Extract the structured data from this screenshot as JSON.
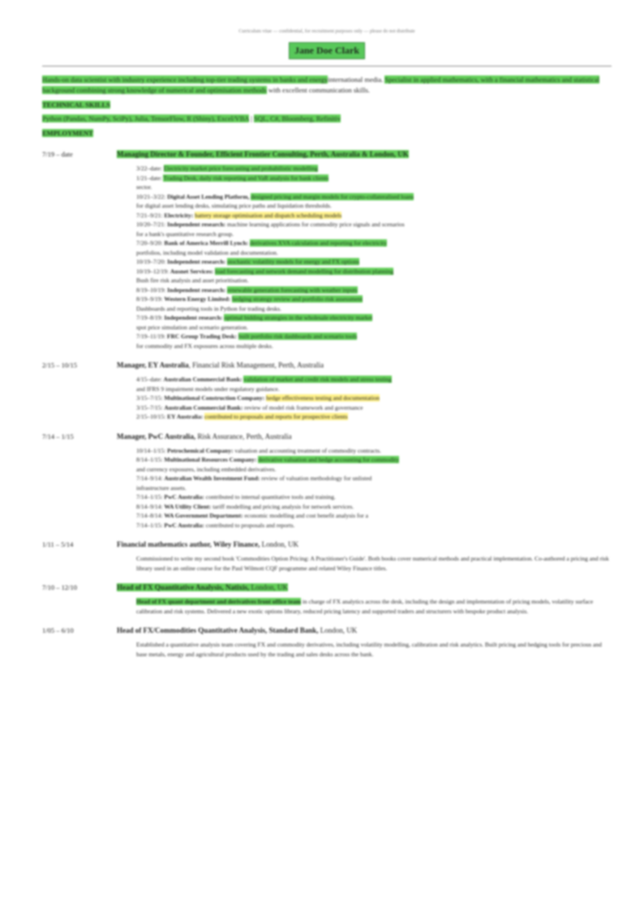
{
  "doc": {
    "top_note": "Curriculum vitae — confidential, for recruitment purposes only — please do not distribute",
    "name": "Jane Doe Clark",
    "summary": [
      {
        "t": "Hands-on data scientist with industry experience including top-tier trading systems in banks and energy",
        "h": "g"
      },
      {
        "t": "international media. ",
        "h": ""
      },
      {
        "t": "Specialist in applied mathematics, with a financial mathematics and statistical background",
        "h": "g"
      },
      {
        "t": " combining strong knowledge of numerical and optimisation methods",
        "h": "g"
      },
      {
        "t": " with excellent communication skills.",
        "h": ""
      }
    ],
    "skills_heading": "TECHNICAL SKILLS",
    "skills_line": [
      {
        "t": "Python (Pandas, NumPy, SciPy), Julia, TensorFlow, R (Shiny), Excel/VBA",
        "h": "g"
      },
      {
        "t": "  |  ",
        "h": ""
      },
      {
        "t": "SQL, C#, Bloomberg, Refinitiv",
        "h": "g"
      }
    ],
    "employment_heading": "EMPLOYMENT",
    "jobs": [
      {
        "date": "7/19 – date",
        "title": [
          {
            "t": "Managing Director & Founder, Efficient Frontier Consulting, Perth, Australia & London, UK",
            "h": "g",
            "b": true
          }
        ],
        "lines": [
          [
            {
              "t": "3/22–date: ",
              "h": ""
            },
            {
              "t": "Electricity market price forecasting and probabilistic modelling",
              "h": "g"
            }
          ],
          [
            {
              "t": "1/21–date: ",
              "h": ""
            },
            {
              "t": "Trading Desk, daily risk reporting and VaR analysis for bank clients",
              "h": "g"
            }
          ],
          [
            {
              "t": "sector.",
              "h": ""
            }
          ],
          [
            {
              "t": "10/21–3/22: ",
              "h": ""
            },
            {
              "t": "Digital Asset Lending Platform, ",
              "h": "",
              "b": true
            },
            {
              "t": "designed pricing and margin models for crypto-collateralised loans",
              "h": "g"
            }
          ],
          [
            {
              "t": "for digital asset lending desks, simulating price paths and liquidation thresholds.",
              "h": ""
            }
          ],
          [
            {
              "t": "7/21–9/21: ",
              "h": ""
            },
            {
              "t": "Electricity: ",
              "h": "",
              "b": true
            },
            {
              "t": "battery storage optimisation and dispatch scheduling models",
              "h": "y"
            }
          ],
          [
            {
              "t": "10/20–7/21: ",
              "h": ""
            },
            {
              "t": "Independent research: ",
              "h": "",
              "b": true
            },
            {
              "t": "machine learning applications for commodity price signals and scenarios",
              "h": ""
            }
          ],
          [
            {
              "t": "for a bank's quantitative research group.",
              "h": ""
            }
          ],
          [
            {
              "t": "7/20–9/20: ",
              "h": ""
            },
            {
              "t": "Bank of America Merrill Lynch: ",
              "h": "",
              "b": true
            },
            {
              "t": "derivatives XVA calculation and reporting for electricity",
              "h": "g"
            }
          ],
          [
            {
              "t": "portfolios, including model validation and documentation.",
              "h": ""
            }
          ],
          [
            {
              "t": "10/19–7/20: ",
              "h": ""
            },
            {
              "t": "Independent research: ",
              "h": "",
              "b": true
            },
            {
              "t": "stochastic volatility models for energy and FX options",
              "h": "g"
            }
          ],
          [
            {
              "t": "10/19–12/19: ",
              "h": ""
            },
            {
              "t": "Ausnet Services: ",
              "h": "",
              "b": true
            },
            {
              "t": "load forecasting and network demand modelling for distribution planning",
              "h": "g"
            }
          ],
          [
            {
              "t": "Bush fire risk analysis and asset prioritisation.",
              "h": ""
            }
          ],
          [
            {
              "t": "8/19–10/19: ",
              "h": ""
            },
            {
              "t": "Independent research: ",
              "h": "",
              "b": true
            },
            {
              "t": "renewable generation forecasting with weather inputs",
              "h": "g"
            }
          ],
          [
            {
              "t": "8/19–9/19: ",
              "h": ""
            },
            {
              "t": "Western Energy Limited: ",
              "h": "",
              "b": true
            },
            {
              "t": "hedging strategy review and portfolio risk assessment",
              "h": "g"
            }
          ],
          [
            {
              "t": "Dashboards and reporting tools in Python for trading desks.",
              "h": ""
            }
          ],
          [
            {
              "t": "7/19–8/19: ",
              "h": ""
            },
            {
              "t": "Independent research: ",
              "h": "",
              "b": true
            },
            {
              "t": "optimal bidding strategies in the wholesale electricity market",
              "h": "g"
            }
          ],
          [
            {
              "t": "spot price simulation and scenario generation.",
              "h": ""
            }
          ],
          [
            {
              "t": "7/19–11/19: ",
              "h": ""
            },
            {
              "t": "FRC Group Trading Desk: ",
              "h": "",
              "b": true
            },
            {
              "t": "built portfolio risk dashboards and scenario tools",
              "h": "g"
            }
          ],
          [
            {
              "t": "for commodity and FX exposures across multiple desks.",
              "h": ""
            }
          ]
        ]
      },
      {
        "date": "2/15 – 10/15",
        "title": [
          {
            "t": "Manager, ",
            "h": "",
            "b": true
          },
          {
            "t": "EY ",
            "h": "",
            "b": true
          },
          {
            "t": "Australia",
            "h": "",
            "b": true
          },
          {
            "t": ", Financial Risk Management, Perth, Australia",
            "h": ""
          }
        ],
        "lines": [
          [
            {
              "t": "4/15–date: ",
              "h": ""
            },
            {
              "t": "Australian Commercial Bank: ",
              "h": "",
              "b": true
            },
            {
              "t": "validation of market and credit risk models and stress testing",
              "h": "g"
            }
          ],
          [
            {
              "t": "and IFRS 9 impairment models under regulatory guidance.",
              "h": ""
            }
          ],
          [
            {
              "t": "3/15–7/15: ",
              "h": ""
            },
            {
              "t": "Multinational Construction Company: ",
              "h": "",
              "b": true
            },
            {
              "t": "hedge effectiveness testing and documentation",
              "h": "y"
            }
          ],
          [
            {
              "t": "3/15–7/15: ",
              "h": ""
            },
            {
              "t": "Australian Commercial Bank: ",
              "h": "",
              "b": true
            },
            {
              "t": "review of model risk framework and governance",
              "h": ""
            }
          ],
          [
            {
              "t": "2/15–10/15: ",
              "h": ""
            },
            {
              "t": "EY Australia: ",
              "h": "",
              "b": true
            },
            {
              "t": "contributed to proposals and reports for prospective clients",
              "h": "y"
            }
          ]
        ]
      },
      {
        "date": "7/14 – 1/15",
        "title": [
          {
            "t": "Manager, PwC Australia, ",
            "h": "",
            "b": true
          },
          {
            "t": "Risk Assurance, Perth, Australia",
            "h": ""
          }
        ],
        "lines": [
          [
            {
              "t": "10/14–1/15: ",
              "h": ""
            },
            {
              "t": "Petrochemical Company: ",
              "h": "",
              "b": true
            },
            {
              "t": "valuation and accounting treatment of commodity contracts.",
              "h": ""
            }
          ],
          [
            {
              "t": "8/14–1/15: ",
              "h": ""
            },
            {
              "t": "Multinational Resources Company: ",
              "h": "",
              "b": true
            },
            {
              "t": "derivative valuation and hedge accounting for commodity",
              "h": "g"
            }
          ],
          [
            {
              "t": "and currency exposures, including embedded derivatives.",
              "h": ""
            }
          ],
          [
            {
              "t": "7/14–9/14: ",
              "h": ""
            },
            {
              "t": "Australian Wealth Investment Fund: ",
              "h": "",
              "b": true
            },
            {
              "t": "review of valuation methodology for unlisted",
              "h": ""
            }
          ],
          [
            {
              "t": "infrastructure assets.",
              "h": ""
            }
          ],
          [
            {
              "t": "7/14–1/15: ",
              "h": ""
            },
            {
              "t": "PwC Australia: ",
              "h": "",
              "b": true
            },
            {
              "t": "contributed to internal quantitative tools and training.",
              "h": ""
            }
          ],
          [
            {
              "t": "8/14–9/14: ",
              "h": ""
            },
            {
              "t": "WA Utility Client: ",
              "h": "",
              "b": true
            },
            {
              "t": "tariff modelling and pricing analysis for network services.",
              "h": ""
            }
          ],
          [
            {
              "t": "7/14–8/14: ",
              "h": ""
            },
            {
              "t": "WA Government Department: ",
              "h": "",
              "b": true
            },
            {
              "t": "economic modelling and cost benefit analysis for a",
              "h": ""
            }
          ],
          [
            {
              "t": "7/14–1/15: ",
              "h": ""
            },
            {
              "t": "PwC Australia: ",
              "h": "",
              "b": true
            },
            {
              "t": "contributed to proposals and reports.",
              "h": ""
            }
          ]
        ]
      },
      {
        "date": "1/11 – 5/14",
        "title": [
          {
            "t": "Financial mathematics author, Wiley Finance, ",
            "h": "",
            "b": true
          },
          {
            "t": "London, UK",
            "h": ""
          }
        ],
        "para": "Commissioned to write my second book 'Commodities Option Pricing: A Practitioner's Guide'. Both books cover numerical methods and practical implementation. Co-authored a pricing and risk library used in an online course for the Paul Wilmott CQF programme and related Wiley Finance titles.",
        "para_hl": ""
      },
      {
        "date": "7/10 – 12/10",
        "title": [
          {
            "t": "Head of FX Quantitative Analysis, Natixis, ",
            "h": "g",
            "b": true
          },
          {
            "t": "London, UK",
            "h": "g"
          }
        ],
        "para_hl": "Head of FX quant department and derivatives front office team",
        "para": " in charge of FX analytics across the desk, including the design and implementation of pricing models, volatility surface calibration and risk systems. Delivered a new exotic options library, reduced pricing latency and supported traders and structurers with bespoke product analysis."
      },
      {
        "date": "1/05 – 6/10",
        "title": [
          {
            "t": "Head of FX/Commodities Quantitative Analysis, Standard Bank, ",
            "h": "",
            "b": true
          },
          {
            "t": "London, UK",
            "h": ""
          }
        ],
        "para_hl": "",
        "para": "Established a quantitative analysis team covering FX and commodity derivatives, including volatility modelling, calibration and risk analytics. Built pricing and hedging tools for precious and base metals, energy and agricultural products used by the trading and sales desks across the bank."
      }
    ]
  }
}
